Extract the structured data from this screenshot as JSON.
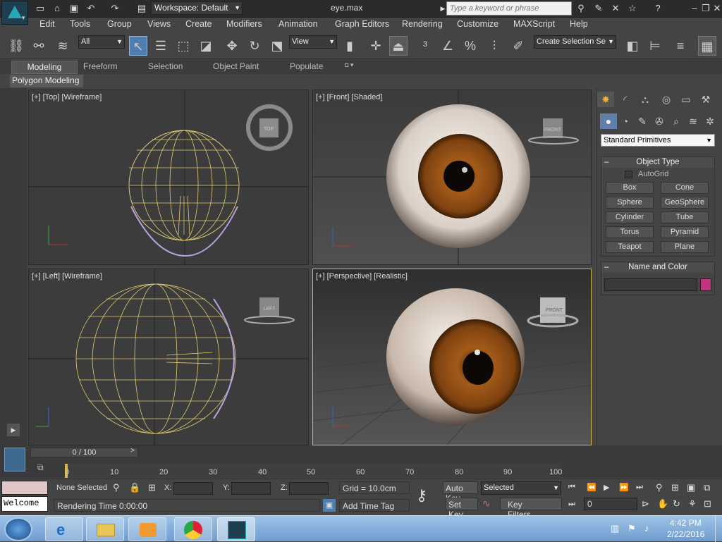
{
  "titlebar": {
    "workspace": "Workspace: Default",
    "filename": "eye.max",
    "search_placeholder": "Type a keyword or phrase"
  },
  "menu": [
    "Edit",
    "Tools",
    "Group",
    "Views",
    "Create",
    "Modifiers",
    "Animation",
    "Graph Editors",
    "Rendering",
    "Customize",
    "MAXScript",
    "Help"
  ],
  "toolbar": {
    "filter": "All",
    "ref_coord": "View",
    "selection_set": "Create Selection Se"
  },
  "ribbon": {
    "tabs": [
      "Modeling",
      "Freeform",
      "Selection",
      "Object Paint",
      "Populate"
    ],
    "panel": "Polygon Modeling"
  },
  "viewports": {
    "top": {
      "label": "[+] [Top] [Wireframe]",
      "cube": "TOP"
    },
    "front": {
      "label": "[+] [Front] [Shaded]",
      "cube": "FRONT"
    },
    "left": {
      "label": "[+] [Left] [Wireframe]",
      "cube": "LEFT"
    },
    "persp": {
      "label": "[+] [Perspective] [Realistic]",
      "cube": "FRONT"
    }
  },
  "command_panel": {
    "category": "Standard Primitives",
    "object_type_title": "Object Type",
    "autogrid": "AutoGrid",
    "buttons": [
      "Box",
      "Cone",
      "Sphere",
      "GeoSphere",
      "Cylinder",
      "Tube",
      "Torus",
      "Pyramid",
      "Teapot",
      "Plane"
    ],
    "name_color_title": "Name and Color",
    "swatch_color": "#c2347e"
  },
  "timeline": {
    "frame": "0 / 100",
    "ticks": [
      "0",
      "10",
      "20",
      "30",
      "40",
      "50",
      "60",
      "70",
      "80",
      "90",
      "100"
    ]
  },
  "status": {
    "selection": "None Selected",
    "x": "X:",
    "y": "Y:",
    "z": "Z:",
    "grid": "Grid = 10.0cm",
    "render_time": "Rendering Time  0:00:00",
    "add_time_tag": "Add Time Tag",
    "auto_key": "Auto Key",
    "set_key": "Set Key",
    "key_mode": "Selected",
    "key_filters": "Key Filters...",
    "frame_value": "0",
    "listener": "Welcome"
  },
  "tray": {
    "time": "4:42 PM",
    "date": "2/22/2016"
  }
}
